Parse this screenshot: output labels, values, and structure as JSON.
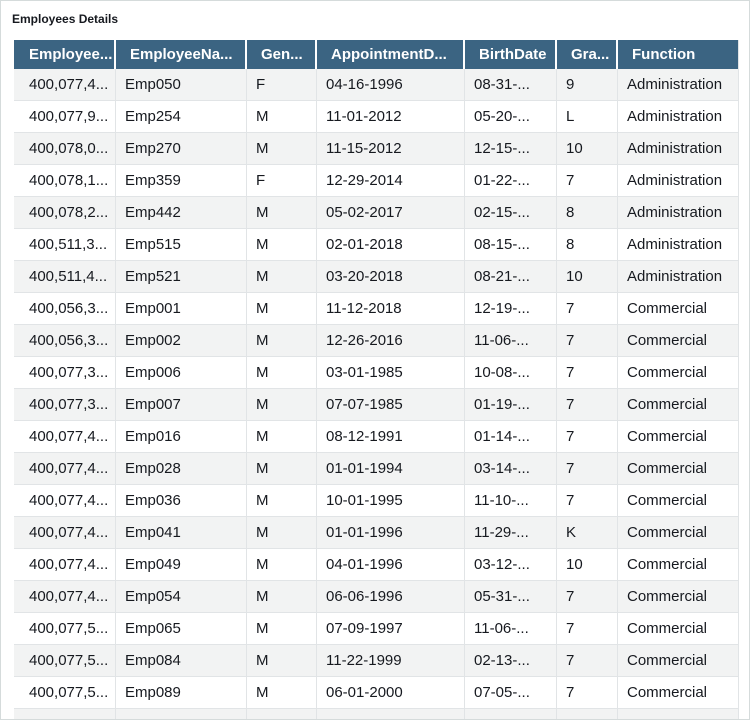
{
  "panel": {
    "title": "Employees Details"
  },
  "table": {
    "columns": [
      "Employee...",
      "EmployeeNa...",
      "Gen...",
      "AppointmentD...",
      "BirthDate",
      "Gra...",
      "Function"
    ],
    "rows": [
      [
        "400,077,4...",
        "Emp050",
        "F",
        "04-16-1996",
        "08-31-...",
        "9",
        "Administration"
      ],
      [
        "400,077,9...",
        "Emp254",
        "M",
        "11-01-2012",
        "05-20-...",
        "L",
        "Administration"
      ],
      [
        "400,078,0...",
        "Emp270",
        "M",
        "11-15-2012",
        "12-15-...",
        "10",
        "Administration"
      ],
      [
        "400,078,1...",
        "Emp359",
        "F",
        "12-29-2014",
        "01-22-...",
        "7",
        "Administration"
      ],
      [
        "400,078,2...",
        "Emp442",
        "M",
        "05-02-2017",
        "02-15-...",
        "8",
        "Administration"
      ],
      [
        "400,511,3...",
        "Emp515",
        "M",
        "02-01-2018",
        "08-15-...",
        "8",
        "Administration"
      ],
      [
        "400,511,4...",
        "Emp521",
        "M",
        "03-20-2018",
        "08-21-...",
        "10",
        "Administration"
      ],
      [
        "400,056,3...",
        "Emp001",
        "M",
        "11-12-2018",
        "12-19-...",
        "7",
        "Commercial"
      ],
      [
        "400,056,3...",
        "Emp002",
        "M",
        "12-26-2016",
        "11-06-...",
        "7",
        "Commercial"
      ],
      [
        "400,077,3...",
        "Emp006",
        "M",
        "03-01-1985",
        "10-08-...",
        "7",
        "Commercial"
      ],
      [
        "400,077,3...",
        "Emp007",
        "M",
        "07-07-1985",
        "01-19-...",
        "7",
        "Commercial"
      ],
      [
        "400,077,4...",
        "Emp016",
        "M",
        "08-12-1991",
        "01-14-...",
        "7",
        "Commercial"
      ],
      [
        "400,077,4...",
        "Emp028",
        "M",
        "01-01-1994",
        "03-14-...",
        "7",
        "Commercial"
      ],
      [
        "400,077,4...",
        "Emp036",
        "M",
        "10-01-1995",
        "11-10-...",
        "7",
        "Commercial"
      ],
      [
        "400,077,4...",
        "Emp041",
        "M",
        "01-01-1996",
        "11-29-...",
        "K",
        "Commercial"
      ],
      [
        "400,077,4...",
        "Emp049",
        "M",
        "04-01-1996",
        "03-12-...",
        "10",
        "Commercial"
      ],
      [
        "400,077,4...",
        "Emp054",
        "M",
        "06-06-1996",
        "05-31-...",
        "7",
        "Commercial"
      ],
      [
        "400,077,5...",
        "Emp065",
        "M",
        "07-09-1997",
        "11-06-...",
        "7",
        "Commercial"
      ],
      [
        "400,077,5...",
        "Emp084",
        "M",
        "11-22-1999",
        "02-13-...",
        "7",
        "Commercial"
      ],
      [
        "400,077,5...",
        "Emp089",
        "M",
        "06-01-2000",
        "07-05-...",
        "7",
        "Commercial"
      ],
      [
        "",
        "",
        "",
        "",
        "",
        "",
        ""
      ]
    ]
  },
  "colors": {
    "header_bg": "#3b6482",
    "header_text": "#ffffff",
    "row_alt_bg": "#f2f3f3",
    "grid_line": "#e1e4e6"
  }
}
